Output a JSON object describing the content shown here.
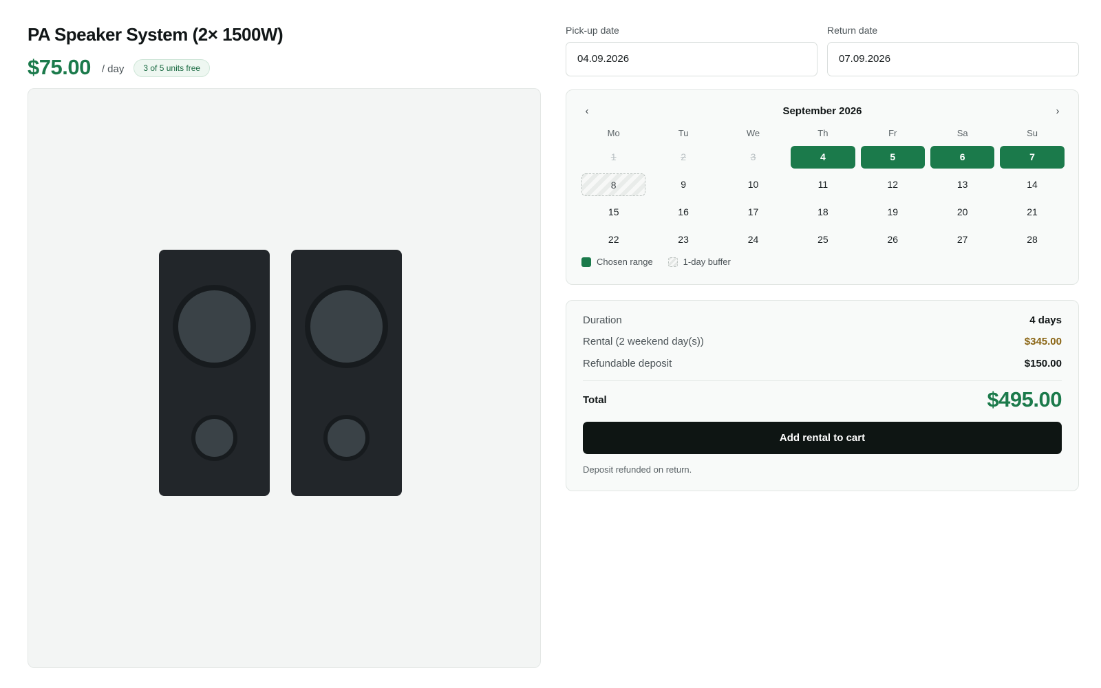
{
  "product": {
    "title": "PA Speaker System (2× 1500W)",
    "price": "$75.00",
    "per": "/ day",
    "availability": "3 of 5 units free"
  },
  "dates": {
    "pickup_label": "Pick-up date",
    "pickup_value": "04.09.2026",
    "return_label": "Return date",
    "return_value": "07.09.2026"
  },
  "calendar": {
    "prev": "‹",
    "next": "›",
    "month": "September 2026",
    "weekdays": [
      "Mo",
      "Tu",
      "We",
      "Th",
      "Fr",
      "Sa",
      "Su"
    ],
    "days": [
      {
        "n": "1",
        "state": "disabled"
      },
      {
        "n": "2",
        "state": "disabled"
      },
      {
        "n": "3",
        "state": "disabled"
      },
      {
        "n": "4",
        "state": "selected"
      },
      {
        "n": "5",
        "state": "selected"
      },
      {
        "n": "6",
        "state": "selected"
      },
      {
        "n": "7",
        "state": "selected"
      },
      {
        "n": "8",
        "state": "buffer"
      },
      {
        "n": "9",
        "state": ""
      },
      {
        "n": "10",
        "state": ""
      },
      {
        "n": "11",
        "state": ""
      },
      {
        "n": "12",
        "state": ""
      },
      {
        "n": "13",
        "state": ""
      },
      {
        "n": "14",
        "state": ""
      },
      {
        "n": "15",
        "state": ""
      },
      {
        "n": "16",
        "state": ""
      },
      {
        "n": "17",
        "state": ""
      },
      {
        "n": "18",
        "state": ""
      },
      {
        "n": "19",
        "state": ""
      },
      {
        "n": "20",
        "state": ""
      },
      {
        "n": "21",
        "state": ""
      },
      {
        "n": "22",
        "state": ""
      },
      {
        "n": "23",
        "state": ""
      },
      {
        "n": "24",
        "state": ""
      },
      {
        "n": "25",
        "state": ""
      },
      {
        "n": "26",
        "state": ""
      },
      {
        "n": "27",
        "state": ""
      },
      {
        "n": "28",
        "state": ""
      }
    ],
    "legend_chosen": "Chosen range",
    "legend_buffer": "1-day buffer"
  },
  "summary": {
    "duration_label": "Duration",
    "duration_value": "4 days",
    "rental_label": "Rental (2 weekend day(s))",
    "rental_value": "$345.00",
    "deposit_label": "Refundable deposit",
    "deposit_value": "$150.00",
    "total_label": "Total",
    "total_value": "$495.00",
    "cta": "Add rental to cart",
    "note": "Deposit refunded on return."
  },
  "colors": {
    "accent": "#1b7a4b",
    "rental_price": "#8a6514",
    "cta_bg": "#0e1513"
  },
  "icons": [
    "chevron-left-icon",
    "chevron-right-icon"
  ]
}
